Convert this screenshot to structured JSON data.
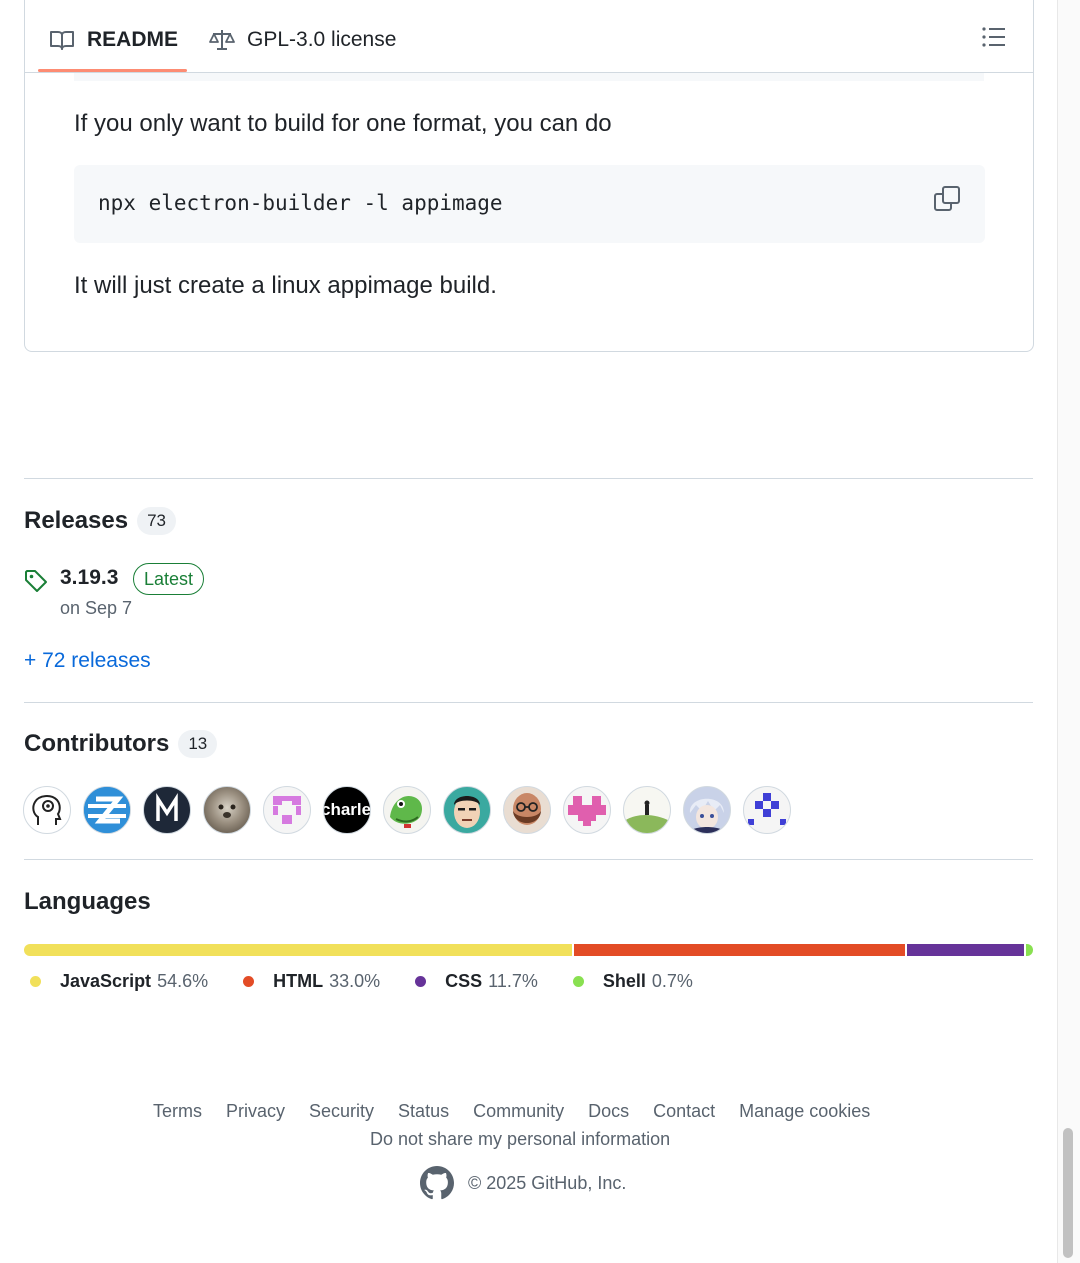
{
  "readme": {
    "tabs": [
      {
        "label": "README",
        "icon": "book-icon"
      },
      {
        "label": "GPL-3.0 license",
        "icon": "law-icon"
      }
    ],
    "paragraph_1": "If you only want to build for one format, you can do",
    "code": "npx electron-builder -l appimage",
    "paragraph_2": "It will just create a linux appimage build."
  },
  "releases": {
    "title": "Releases",
    "count": "73",
    "latest_version": "3.19.3",
    "latest_badge": "Latest",
    "date": "on Sep 7",
    "more_link": "+ 72 releases"
  },
  "contributors": {
    "title": "Contributors",
    "count": "13",
    "avatars": [
      {
        "icon": "head-gear-avatar",
        "label": ""
      },
      {
        "icon": "z-logo-avatar",
        "label": ""
      },
      {
        "icon": "m-letter-avatar",
        "label": ""
      },
      {
        "icon": "koala-photo-avatar",
        "label": ""
      },
      {
        "icon": "pink-pixel-avatar",
        "label": ""
      },
      {
        "icon": "charle-text-avatar",
        "label": "charle"
      },
      {
        "icon": "frog-avatar",
        "label": ""
      },
      {
        "icon": "cartoon-face-avatar",
        "label": ""
      },
      {
        "icon": "bearded-man-avatar",
        "label": ""
      },
      {
        "icon": "pink-heart-pixel-avatar",
        "label": ""
      },
      {
        "icon": "hill-figure-avatar",
        "label": ""
      },
      {
        "icon": "anime-avatar",
        "label": ""
      },
      {
        "icon": "blue-pixel-avatar",
        "label": ""
      }
    ]
  },
  "languages": {
    "title": "Languages",
    "items": [
      {
        "name": "JavaScript",
        "percent": "54.6%",
        "value": 54.6,
        "color": "#f1e05a"
      },
      {
        "name": "HTML",
        "percent": "33.0%",
        "value": 33.0,
        "color": "#e34c26"
      },
      {
        "name": "CSS",
        "percent": "11.7%",
        "value": 11.7,
        "color": "#663399"
      },
      {
        "name": "Shell",
        "percent": "0.7%",
        "value": 0.7,
        "color": "#89e051"
      }
    ]
  },
  "footer": {
    "links": [
      "Terms",
      "Privacy",
      "Security",
      "Status",
      "Community",
      "Docs",
      "Contact",
      "Manage cookies"
    ],
    "privacy": "Do not share my personal information",
    "copyright": "© 2025 GitHub, Inc."
  }
}
